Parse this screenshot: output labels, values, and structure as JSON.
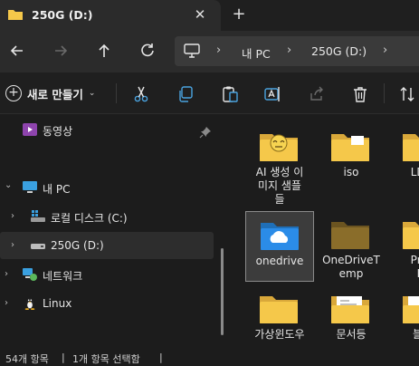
{
  "tab": {
    "title": "250G (D:)",
    "close_glyph": "✕",
    "new_tab_glyph": "+"
  },
  "address": {
    "crumbs": [
      "내 PC",
      "250G (D:)"
    ],
    "separator": "›"
  },
  "toolbar": {
    "new_label": "새로 만들기",
    "new_caret": "⌄",
    "plus": "+"
  },
  "sidebar": {
    "items": [
      {
        "label": "동영상",
        "icon": "video-icon",
        "pinned": true
      },
      {
        "label": "내 PC",
        "icon": "pc-icon",
        "expanded": true,
        "chevron": "⌄"
      },
      {
        "label": "로컬 디스크 (C:)",
        "icon": "windows-drive-icon",
        "chevron": "›"
      },
      {
        "label": "250G (D:)",
        "icon": "drive-icon",
        "chevron": "›",
        "selected": true
      },
      {
        "label": "네트워크",
        "icon": "network-icon",
        "chevron": "›"
      },
      {
        "label": "Linux",
        "icon": "linux-icon",
        "chevron": "›"
      }
    ]
  },
  "files": [
    {
      "label": "AI 생성 이미지 샘플들",
      "line1": "AI 생성 이",
      "line2": "미지 샘플",
      "line3": "들",
      "icon": "folder-emoji-icon"
    },
    {
      "label": "iso",
      "icon": "folder-icon"
    },
    {
      "label": "LDPl",
      "icon": "folder-icon"
    },
    {
      "label": "onedrive",
      "icon": "onedrive-folder-icon",
      "selected": true
    },
    {
      "label": "OneDriveTemp",
      "line1": "OneDriveT",
      "line2": "emp",
      "icon": "folder-dark-icon"
    },
    {
      "label": "ProgFil",
      "line1": "Prog",
      "line2": "Fil",
      "icon": "folder-icon"
    },
    {
      "label": "가상윈도우",
      "icon": "folder-icon"
    },
    {
      "label": "문서등",
      "icon": "folder-docs-icon"
    },
    {
      "label": "블로",
      "icon": "folder-docs-icon"
    }
  ],
  "status": {
    "count": "54개 항목",
    "selection": "1개 항목 선택함",
    "divider": "|"
  },
  "colors": {
    "folder": "#f5c84a",
    "folder_dark": "#8a6d2a",
    "onedrive": "#2b8ce8",
    "accent": "#4aa3df"
  }
}
